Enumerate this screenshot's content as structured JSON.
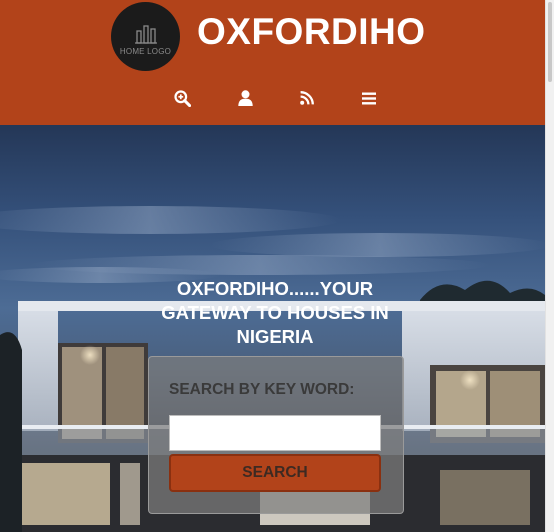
{
  "header": {
    "logo_text": "HOME LOGO",
    "site_title": "OXFORDIHO",
    "background_color": "#b2431a"
  },
  "nav": {
    "items": [
      {
        "icon": "search-zoom-icon"
      },
      {
        "icon": "user-icon"
      },
      {
        "icon": "rss-icon"
      },
      {
        "icon": "menu-icon"
      }
    ]
  },
  "hero": {
    "tagline": "OXFORDIHO......YOUR GATEWAY TO HOUSES IN NIGERIA",
    "search": {
      "label": "SEARCH BY KEY WORD:",
      "input_value": "",
      "input_placeholder": "",
      "button_label": "SEARCH"
    }
  }
}
